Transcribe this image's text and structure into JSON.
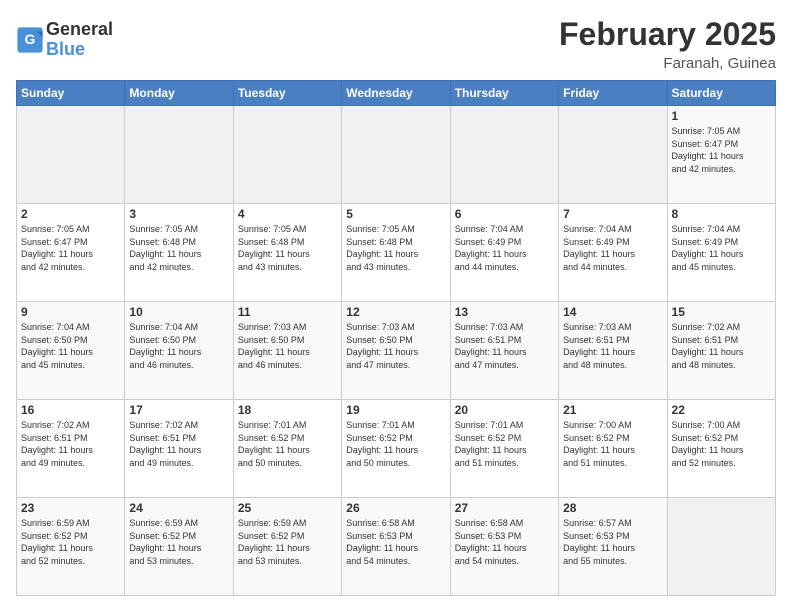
{
  "header": {
    "logo_general": "General",
    "logo_blue": "Blue",
    "month": "February 2025",
    "location": "Faranah, Guinea"
  },
  "days_of_week": [
    "Sunday",
    "Monday",
    "Tuesday",
    "Wednesday",
    "Thursday",
    "Friday",
    "Saturday"
  ],
  "weeks": [
    [
      {
        "day": "",
        "info": ""
      },
      {
        "day": "",
        "info": ""
      },
      {
        "day": "",
        "info": ""
      },
      {
        "day": "",
        "info": ""
      },
      {
        "day": "",
        "info": ""
      },
      {
        "day": "",
        "info": ""
      },
      {
        "day": "1",
        "info": "Sunrise: 7:05 AM\nSunset: 6:47 PM\nDaylight: 11 hours\nand 42 minutes."
      }
    ],
    [
      {
        "day": "2",
        "info": "Sunrise: 7:05 AM\nSunset: 6:47 PM\nDaylight: 11 hours\nand 42 minutes."
      },
      {
        "day": "3",
        "info": "Sunrise: 7:05 AM\nSunset: 6:48 PM\nDaylight: 11 hours\nand 42 minutes."
      },
      {
        "day": "4",
        "info": "Sunrise: 7:05 AM\nSunset: 6:48 PM\nDaylight: 11 hours\nand 43 minutes."
      },
      {
        "day": "5",
        "info": "Sunrise: 7:05 AM\nSunset: 6:48 PM\nDaylight: 11 hours\nand 43 minutes."
      },
      {
        "day": "6",
        "info": "Sunrise: 7:04 AM\nSunset: 6:49 PM\nDaylight: 11 hours\nand 44 minutes."
      },
      {
        "day": "7",
        "info": "Sunrise: 7:04 AM\nSunset: 6:49 PM\nDaylight: 11 hours\nand 44 minutes."
      },
      {
        "day": "8",
        "info": "Sunrise: 7:04 AM\nSunset: 6:49 PM\nDaylight: 11 hours\nand 45 minutes."
      }
    ],
    [
      {
        "day": "9",
        "info": "Sunrise: 7:04 AM\nSunset: 6:50 PM\nDaylight: 11 hours\nand 45 minutes."
      },
      {
        "day": "10",
        "info": "Sunrise: 7:04 AM\nSunset: 6:50 PM\nDaylight: 11 hours\nand 46 minutes."
      },
      {
        "day": "11",
        "info": "Sunrise: 7:03 AM\nSunset: 6:50 PM\nDaylight: 11 hours\nand 46 minutes."
      },
      {
        "day": "12",
        "info": "Sunrise: 7:03 AM\nSunset: 6:50 PM\nDaylight: 11 hours\nand 47 minutes."
      },
      {
        "day": "13",
        "info": "Sunrise: 7:03 AM\nSunset: 6:51 PM\nDaylight: 11 hours\nand 47 minutes."
      },
      {
        "day": "14",
        "info": "Sunrise: 7:03 AM\nSunset: 6:51 PM\nDaylight: 11 hours\nand 48 minutes."
      },
      {
        "day": "15",
        "info": "Sunrise: 7:02 AM\nSunset: 6:51 PM\nDaylight: 11 hours\nand 48 minutes."
      }
    ],
    [
      {
        "day": "16",
        "info": "Sunrise: 7:02 AM\nSunset: 6:51 PM\nDaylight: 11 hours\nand 49 minutes."
      },
      {
        "day": "17",
        "info": "Sunrise: 7:02 AM\nSunset: 6:51 PM\nDaylight: 11 hours\nand 49 minutes."
      },
      {
        "day": "18",
        "info": "Sunrise: 7:01 AM\nSunset: 6:52 PM\nDaylight: 11 hours\nand 50 minutes."
      },
      {
        "day": "19",
        "info": "Sunrise: 7:01 AM\nSunset: 6:52 PM\nDaylight: 11 hours\nand 50 minutes."
      },
      {
        "day": "20",
        "info": "Sunrise: 7:01 AM\nSunset: 6:52 PM\nDaylight: 11 hours\nand 51 minutes."
      },
      {
        "day": "21",
        "info": "Sunrise: 7:00 AM\nSunset: 6:52 PM\nDaylight: 11 hours\nand 51 minutes."
      },
      {
        "day": "22",
        "info": "Sunrise: 7:00 AM\nSunset: 6:52 PM\nDaylight: 11 hours\nand 52 minutes."
      }
    ],
    [
      {
        "day": "23",
        "info": "Sunrise: 6:59 AM\nSunset: 6:52 PM\nDaylight: 11 hours\nand 52 minutes."
      },
      {
        "day": "24",
        "info": "Sunrise: 6:59 AM\nSunset: 6:52 PM\nDaylight: 11 hours\nand 53 minutes."
      },
      {
        "day": "25",
        "info": "Sunrise: 6:59 AM\nSunset: 6:52 PM\nDaylight: 11 hours\nand 53 minutes."
      },
      {
        "day": "26",
        "info": "Sunrise: 6:58 AM\nSunset: 6:53 PM\nDaylight: 11 hours\nand 54 minutes."
      },
      {
        "day": "27",
        "info": "Sunrise: 6:58 AM\nSunset: 6:53 PM\nDaylight: 11 hours\nand 54 minutes."
      },
      {
        "day": "28",
        "info": "Sunrise: 6:57 AM\nSunset: 6:53 PM\nDaylight: 11 hours\nand 55 minutes."
      },
      {
        "day": "",
        "info": ""
      }
    ]
  ]
}
